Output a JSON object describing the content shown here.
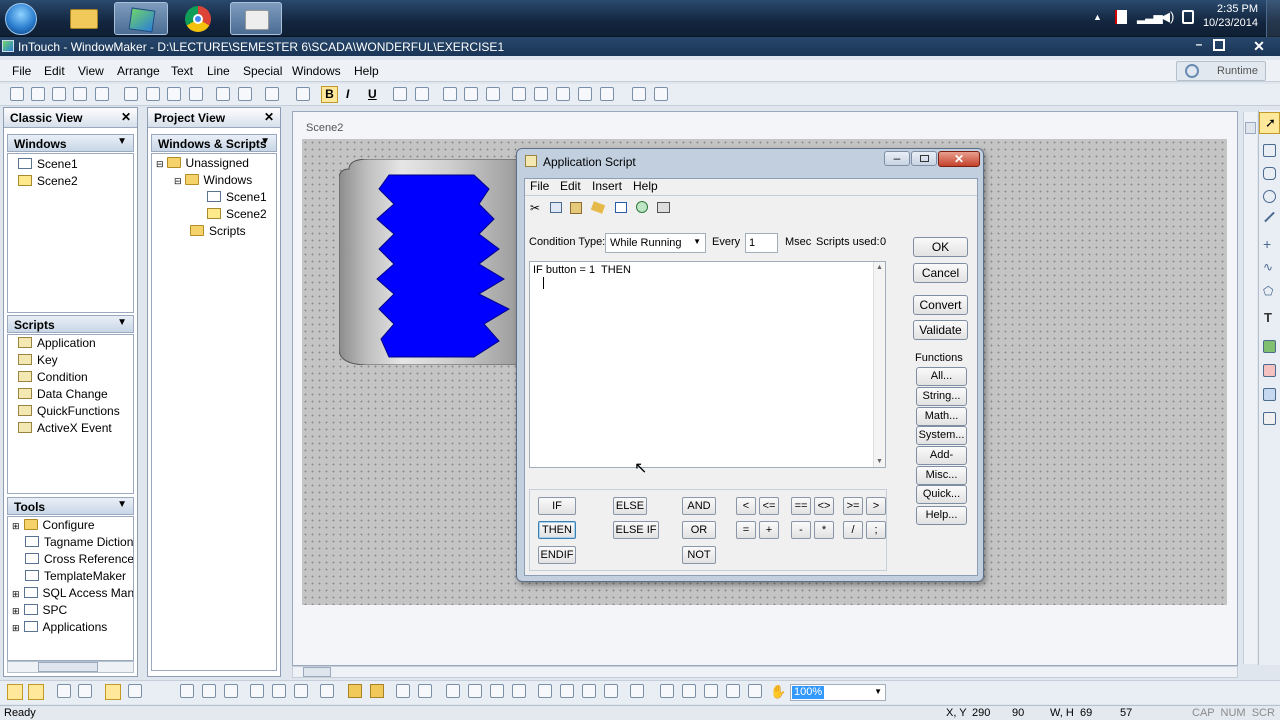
{
  "taskbar": {
    "time": "2:35 PM",
    "date": "10/23/2014"
  },
  "window": {
    "title": "InTouch - WindowMaker - D:\\LECTURE\\SEMESTER 6\\SCADA\\WONDERFUL\\EXERCISE1",
    "runtime_label": "Runtime"
  },
  "menu": [
    "File",
    "Edit",
    "View",
    "Arrange",
    "Text",
    "Line",
    "Special",
    "Windows",
    "Help"
  ],
  "classic_view": {
    "title": "Classic View",
    "windows_header": "Windows",
    "windows": [
      "Scene1",
      "Scene2"
    ],
    "scripts_header": "Scripts",
    "scripts": [
      "Application",
      "Key",
      "Condition",
      "Data Change",
      "QuickFunctions",
      "ActiveX Event"
    ],
    "tools_header": "Tools",
    "tools": [
      "Configure",
      "Tagname Dictiona",
      "Cross Reference",
      "TemplateMaker",
      "SQL Access Mana",
      "SPC",
      "Applications"
    ]
  },
  "project_view": {
    "title": "Project View",
    "header": "Windows & Scripts",
    "root": "Unassigned",
    "windows_folder": "Windows",
    "windows": [
      "Scene1",
      "Scene2"
    ],
    "scripts_folder": "Scripts"
  },
  "canvas": {
    "tab": "Scene2"
  },
  "dialog": {
    "title": "Application Script",
    "menu": [
      "File",
      "Edit",
      "Insert",
      "Help"
    ],
    "condition_label": "Condition Type:",
    "condition_value": "While Running",
    "every_label": "Every",
    "every_value": "1",
    "msec_label": "Msec",
    "scripts_used_label": "Scripts used:",
    "scripts_used_value": "0",
    "script_text": "IF button = 1  THEN",
    "buttons": {
      "ok": "OK",
      "cancel": "Cancel",
      "convert": "Convert",
      "validate": "Validate"
    },
    "functions_label": "Functions",
    "functions": [
      "All...",
      "String...",
      "Math...",
      "System...",
      "Add-ons...",
      "Misc...",
      "Quick...",
      "Help..."
    ],
    "keywords": {
      "if": "IF",
      "then": "THEN",
      "endif": "ENDIF",
      "else": "ELSE",
      "elseif": "ELSE IF",
      "and": "AND",
      "or": "OR",
      "not": "NOT"
    },
    "operators": [
      "<",
      "<=",
      "==",
      "<>",
      ">=",
      ">",
      "=",
      "+",
      "-",
      "*",
      "/",
      ";"
    ]
  },
  "zoom": "100%",
  "status": {
    "ready": "Ready",
    "xy_label": "X, Y",
    "x": "290",
    "y": "90",
    "wh_label": "W, H",
    "w": "69",
    "h": "57",
    "indicators": "CAP  NUM  SCR"
  }
}
